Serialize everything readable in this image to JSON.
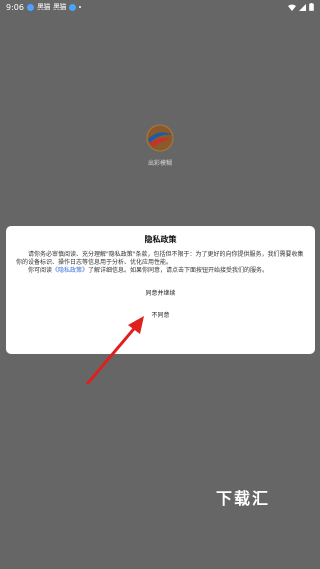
{
  "status": {
    "time": "9:06",
    "app_icon_1": "黑猫",
    "app_icon_2": "黑猫"
  },
  "splash": {
    "app_name": "出彩模糊"
  },
  "dialog": {
    "title": "隐私政策",
    "para1_a": "请你务必审慎阅读、充分理解\"隐私政策\"条款，包括但不限于：为了更好的向你提供服务，我们需要收集你的设备标识、操作日志等信息用于分析、优化应用性能。",
    "para2_a": "你可阅读",
    "para2_link": "《隐私政策》",
    "para2_b": "了解详细信息。如果你同意，请点击下面按钮开始接受我们的服务。",
    "agree": "同意并继续",
    "disagree": "不同意"
  },
  "watermark": "下载汇",
  "colors": {
    "overlay": "#666666",
    "link": "#3a6fd8",
    "arrow": "#e0201c"
  }
}
